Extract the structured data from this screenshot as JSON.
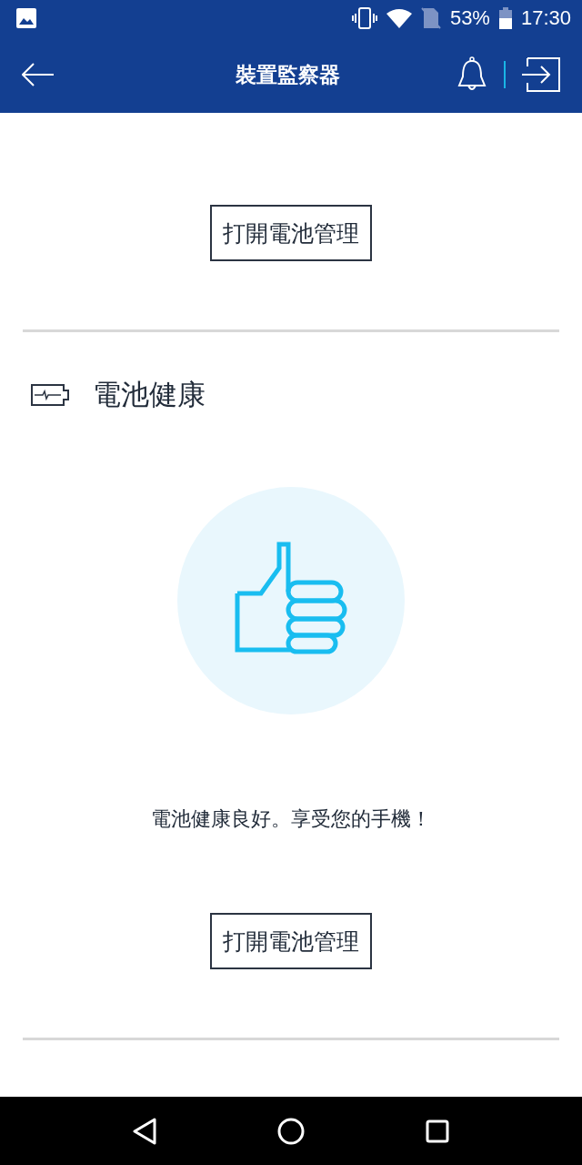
{
  "status_bar": {
    "battery": "53%",
    "time": "17:30"
  },
  "app_bar": {
    "title": "裝置監察器"
  },
  "temperature_section": {
    "button": "打開電池管理"
  },
  "battery_health": {
    "title": "電池健康",
    "message": "電池健康良好。享受您的手機！",
    "button": "打開電池管理"
  }
}
